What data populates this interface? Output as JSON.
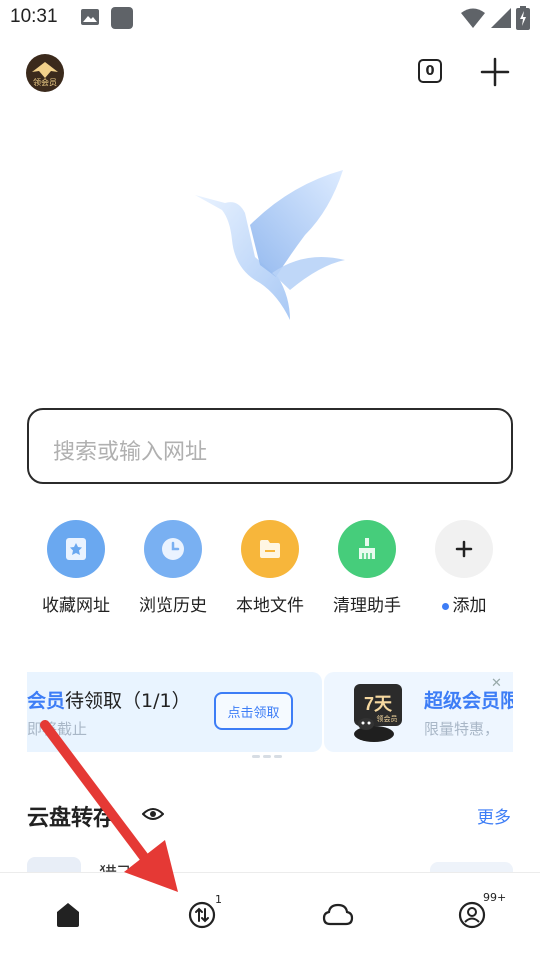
{
  "status_bar": {
    "time": "10:31"
  },
  "top_bar": {
    "avatar_label": "领会员",
    "tab_count": "0"
  },
  "search": {
    "placeholder": "搜索或输入网址"
  },
  "shortcuts": [
    {
      "label": "收藏网址",
      "icon": "star-bookmark-icon",
      "color": "#6aa8f0"
    },
    {
      "label": "浏览历史",
      "icon": "clock-icon",
      "color": "#79b0f2"
    },
    {
      "label": "本地文件",
      "icon": "folder-icon",
      "color": "#f7b63b"
    },
    {
      "label": "清理助手",
      "icon": "broom-icon",
      "color": "#46cd7b"
    },
    {
      "label": "添加",
      "icon": "plus-icon",
      "color": "#f1f1f1"
    }
  ],
  "banner": {
    "card1": {
      "title_prefix": "会员",
      "title": "待领取（1/1）",
      "subtitle": "即将截止",
      "button": "点击领取"
    },
    "card2": {
      "badge_text": "7天",
      "badge_sub": "领会员",
      "title": "超级会员限",
      "subtitle": "限量特惠，"
    }
  },
  "cloud": {
    "title": "云盘转存",
    "more": "更多",
    "row_text": "猎飞"
  },
  "bottom_nav": [
    {
      "name": "home",
      "badge": ""
    },
    {
      "name": "transfer",
      "badge": "1"
    },
    {
      "name": "cloud",
      "badge": ""
    },
    {
      "name": "profile",
      "badge": "99+"
    }
  ],
  "colors": {
    "accent": "#3d7df6",
    "arrow": "#e53935"
  }
}
